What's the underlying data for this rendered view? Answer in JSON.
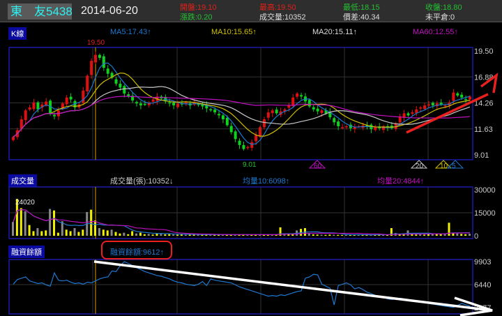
{
  "header": {
    "stock_name": "東　友",
    "stock_code": "5438",
    "date": "2014-06-20",
    "open": "開盤:19.10",
    "high": "最高:19.50",
    "low": "最低:18.15",
    "close": "收盤:18.80",
    "change": "漲跌:0.20",
    "volume": "成交量:10352",
    "spread": "價差:40.34",
    "open_interest": "未平倉:0"
  },
  "kline": {
    "tab": "K線",
    "ma5": "MA5:17.43↑",
    "ma10": "MA10:15.65↑",
    "ma20": "MA20:15.11↑",
    "ma60": "MA60:12.55↑",
    "high_label": "19.50",
    "low_label": "9.01",
    "axis": [
      "19.50",
      "16.88",
      "14.26",
      "11.63",
      "9.01"
    ],
    "markers": [
      "60",
      "20",
      "10",
      "5"
    ]
  },
  "volume_panel": {
    "tab": "成交量",
    "vol": "成交量(張):10352↓",
    "avg10": "均量10:6098↑",
    "avg20": "均量20:4844↑",
    "peak_label": "24020",
    "axis": [
      "30000",
      "15000",
      "0"
    ]
  },
  "margin_panel": {
    "tab": "融資餘額",
    "value": "融資餘額:9612↑",
    "axis": [
      "9903",
      "6440",
      "2977"
    ]
  },
  "colors": {
    "ma5": "#1e78d0",
    "ma10": "#d0c000",
    "ma20": "#c8c8c8",
    "ma60": "#c010c0",
    "up": "#e01010",
    "down": "#10d020",
    "annotation": "#e82020"
  },
  "chart_data": {
    "type": "candlestick",
    "price_range": [
      9.01,
      19.5
    ],
    "closes": [
      10.8,
      11.5,
      12.6,
      13.5,
      13.8,
      14.3,
      13.6,
      14.1,
      14.4,
      13.2,
      12.9,
      13.5,
      14.2,
      14.8,
      14.6,
      13.8,
      14.1,
      15.5,
      17.0,
      18.5,
      19.1,
      18.8,
      17.8,
      17.2,
      16.8,
      16.2,
      15.8,
      15.2,
      14.9,
      14.5,
      14.2,
      14.0,
      14.1,
      14.3,
      14.6,
      14.9,
      14.7,
      14.4,
      14.2,
      14.0,
      14.2,
      14.1,
      14.3,
      14.0,
      14.3,
      14.1,
      13.9,
      13.7,
      13.5,
      13.3,
      13.0,
      12.6,
      12.0,
      11.3,
      10.6,
      10.0,
      9.6,
      9.8,
      10.3,
      11.0,
      11.8,
      12.6,
      13.3,
      13.5,
      13.2,
      13.4,
      13.6,
      14.0,
      14.8,
      15.2,
      14.9,
      14.4,
      13.9,
      13.6,
      13.4,
      13.5,
      13.2,
      12.8,
      12.3,
      11.9,
      11.8,
      11.9,
      11.7,
      11.8,
      11.9,
      12.0,
      11.9,
      11.6,
      11.8,
      11.7,
      11.9,
      11.8,
      11.7,
      12.2,
      12.9,
      13.2,
      13.0,
      13.3,
      13.6,
      13.8,
      14.0,
      14.1,
      14.0,
      14.2,
      14.1,
      14.0,
      14.3,
      15.3,
      15.0,
      14.8,
      14.6,
      14.9
    ],
    "volume_range": [
      0,
      30000
    ],
    "volumes": [
      9000,
      24020,
      18000,
      16000,
      7000,
      3000,
      5000,
      3000,
      3500,
      17500,
      16500,
      2000,
      9500,
      4000,
      3000,
      5000,
      2500,
      4000,
      15500,
      17000,
      10000,
      5000,
      4000,
      3500,
      4000,
      2500,
      1500,
      2000,
      1000,
      3000,
      1500,
      2000,
      1000,
      1200,
      800,
      1500,
      1200,
      900,
      1000,
      800,
      700,
      900,
      600,
      800,
      1000,
      700,
      600,
      900,
      800,
      500,
      700,
      600,
      800,
      900,
      700,
      600,
      1000,
      800,
      700,
      900,
      600,
      800,
      700,
      600,
      900,
      5500,
      1500,
      1200,
      1000,
      3500,
      4500,
      5000,
      1500,
      900,
      800,
      700,
      600,
      800,
      700,
      600,
      500,
      700,
      600,
      800,
      700,
      500,
      600,
      700,
      800,
      600,
      500,
      700,
      5000,
      1800,
      1000,
      1500,
      3500,
      1200,
      800,
      900,
      700,
      1000,
      1500,
      1200,
      1000,
      1100,
      8500,
      2000,
      1500,
      1200,
      1000,
      1300
    ],
    "margin_range": [
      2977,
      9903
    ],
    "margin": [
      6500,
      7200,
      7400,
      7600,
      7000,
      6800,
      6600,
      6700,
      6400,
      6200,
      8200,
      7100,
      7000,
      7100,
      6800,
      6600,
      6700,
      6500,
      6800,
      6700,
      7000,
      7300,
      7500,
      7600,
      8500,
      8400,
      9300,
      9903,
      9600,
      9300,
      9000,
      8700,
      8400,
      8200,
      8000,
      7800,
      7700,
      7500,
      7300,
      7000,
      6800,
      6700,
      6500,
      6400,
      6300,
      6500,
      6900,
      6300,
      7300,
      7100,
      7000,
      6900,
      6800,
      6700,
      6400,
      6100,
      5900,
      5700,
      5500,
      5300,
      5100,
      4900,
      4700,
      4800,
      4700,
      4900,
      4800,
      5000,
      5200,
      5400,
      5500,
      7400,
      7600,
      8000,
      7900,
      6500,
      6200,
      5900,
      3400,
      6300,
      6500,
      6700,
      6400,
      5800,
      6000,
      5700,
      5300,
      5100,
      4800,
      4600,
      4500,
      4300,
      4200,
      4300,
      4400,
      4300,
      4200,
      4100,
      4000,
      3900,
      3800,
      3600,
      3500,
      3400,
      3300,
      3200,
      3100,
      3000,
      3300,
      3600,
      3400,
      3200
    ]
  }
}
